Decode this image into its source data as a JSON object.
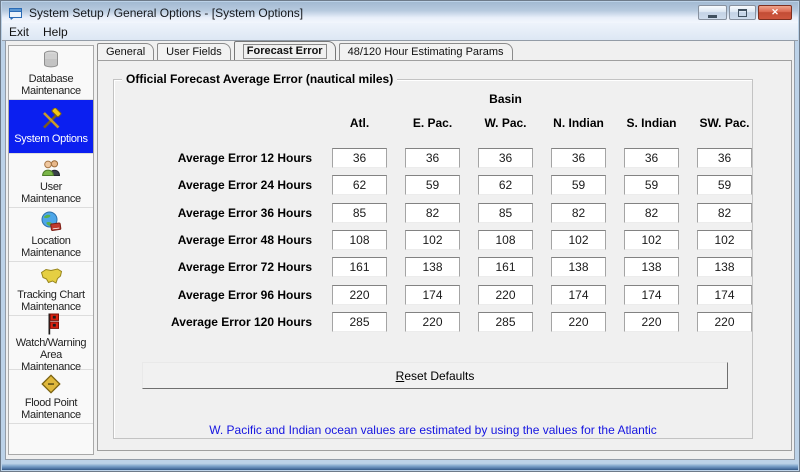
{
  "window": {
    "title": "System Setup / General Options - [System Options]",
    "icon": "app-icon",
    "buttons": [
      {
        "icon": "minimize-icon"
      },
      {
        "icon": "maximize-icon"
      },
      {
        "icon": "close-icon",
        "glyph": "✕"
      }
    ]
  },
  "menu": {
    "items": [
      "Exit",
      "Help"
    ]
  },
  "sidebar": {
    "items": [
      {
        "label": "Database Maintenance",
        "icon": "database-icon",
        "selected": false
      },
      {
        "label": "System Options",
        "icon": "tools-icon",
        "selected": true
      },
      {
        "label": "User Maintenance",
        "icon": "users-icon",
        "selected": false
      },
      {
        "label": "Location Maintenance",
        "icon": "globe-book-icon",
        "selected": false
      },
      {
        "label": "Tracking Chart Maintenance",
        "icon": "map-icon",
        "selected": false
      },
      {
        "label": "Watch/Warning Area Maintenance",
        "icon": "warning-flags-icon",
        "selected": false
      },
      {
        "label": "Flood Point Maintenance",
        "icon": "diamond-sign-icon",
        "selected": false
      }
    ]
  },
  "tabs": [
    {
      "label": "General",
      "active": false
    },
    {
      "label": "User Fields",
      "active": false
    },
    {
      "label": "Forecast Error",
      "active": true
    },
    {
      "label": "48/120 Hour Estimating Params",
      "active": false
    }
  ],
  "forecast_panel": {
    "group_title": "Official Forecast Average Error (nautical miles)",
    "basin_label": "Basin",
    "basin_column_index": 2,
    "columns": [
      "Atl.",
      "E. Pac.",
      "W. Pac.",
      "N. Indian",
      "S. Indian",
      "SW. Pac."
    ],
    "rows": [
      {
        "label": "Average Error 12 Hours",
        "values": [
          "36",
          "36",
          "36",
          "36",
          "36",
          "36"
        ]
      },
      {
        "label": "Average Error 24 Hours",
        "values": [
          "62",
          "59",
          "62",
          "59",
          "59",
          "59"
        ]
      },
      {
        "label": "Average Error 36 Hours",
        "values": [
          "85",
          "82",
          "85",
          "82",
          "82",
          "82"
        ]
      },
      {
        "label": "Average Error 48 Hours",
        "values": [
          "108",
          "102",
          "108",
          "102",
          "102",
          "102"
        ]
      },
      {
        "label": "Average Error 72 Hours",
        "values": [
          "161",
          "138",
          "161",
          "138",
          "138",
          "138"
        ]
      },
      {
        "label": "Average Error 96 Hours",
        "values": [
          "220",
          "174",
          "220",
          "174",
          "174",
          "174"
        ]
      },
      {
        "label": "Average Error 120 Hours",
        "values": [
          "285",
          "220",
          "285",
          "220",
          "220",
          "220"
        ]
      }
    ],
    "reset_button": {
      "label": "Reset Defaults",
      "underline_index": 0
    },
    "note": "W. Pacific and Indian ocean values are estimated by using the values for the Atlantic"
  },
  "colors": {
    "selection_bg": "#0b1ff0",
    "selection_text": "#ffffff",
    "note_text": "#1515e0",
    "close_button_red": "#cf573e",
    "window_frame_blue": "#bcd2e8"
  }
}
